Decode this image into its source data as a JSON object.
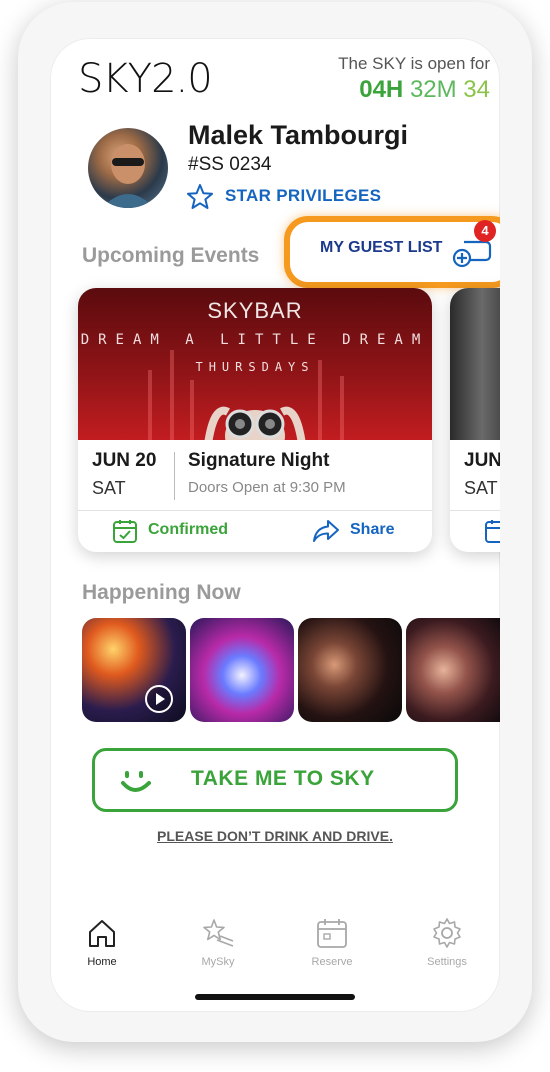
{
  "app": {
    "logo_main": "SKY",
    "logo_version": "2.0"
  },
  "status": {
    "open_text": "The SKY is open for",
    "hours": "04H",
    "minutes": "32M",
    "seconds": "34"
  },
  "profile": {
    "name": "Malek Tambourgi",
    "member_id": "#SS 0234",
    "privileges_label": "STAR PRIVILEGES"
  },
  "events": {
    "section_title": "Upcoming Events",
    "guest_list_label": "MY GUEST LIST",
    "guest_list_count": "4",
    "items": [
      {
        "image_brand": "SKYBAR",
        "image_line1": "DREAM A LITTLE DREAM",
        "image_line2": "THURSDAYS",
        "date": "JUN 20",
        "day": "SAT",
        "name": "Signature Night",
        "doors": "Doors Open at 9:30 PM",
        "status_label": "Confirmed",
        "share_label": "Share"
      },
      {
        "date": "JUN",
        "day": "SAT"
      }
    ]
  },
  "happening": {
    "section_title": "Happening Now"
  },
  "cta": {
    "label": "TAKE ME TO SKY",
    "disclaimer": "PLEASE DON’T DRINK AND DRIVE."
  },
  "nav": {
    "items": [
      {
        "label": "Home",
        "icon": "home-icon",
        "active": true
      },
      {
        "label": "MySky",
        "icon": "star-trail-icon",
        "active": false
      },
      {
        "label": "Reserve",
        "icon": "calendar-icon",
        "active": false
      },
      {
        "label": "Settings",
        "icon": "gear-icon",
        "active": false
      }
    ]
  },
  "colors": {
    "accent_green": "#3aa33a",
    "accent_blue": "#1565c0",
    "highlight_orange": "#f59a1f",
    "badge_red": "#e02424"
  }
}
